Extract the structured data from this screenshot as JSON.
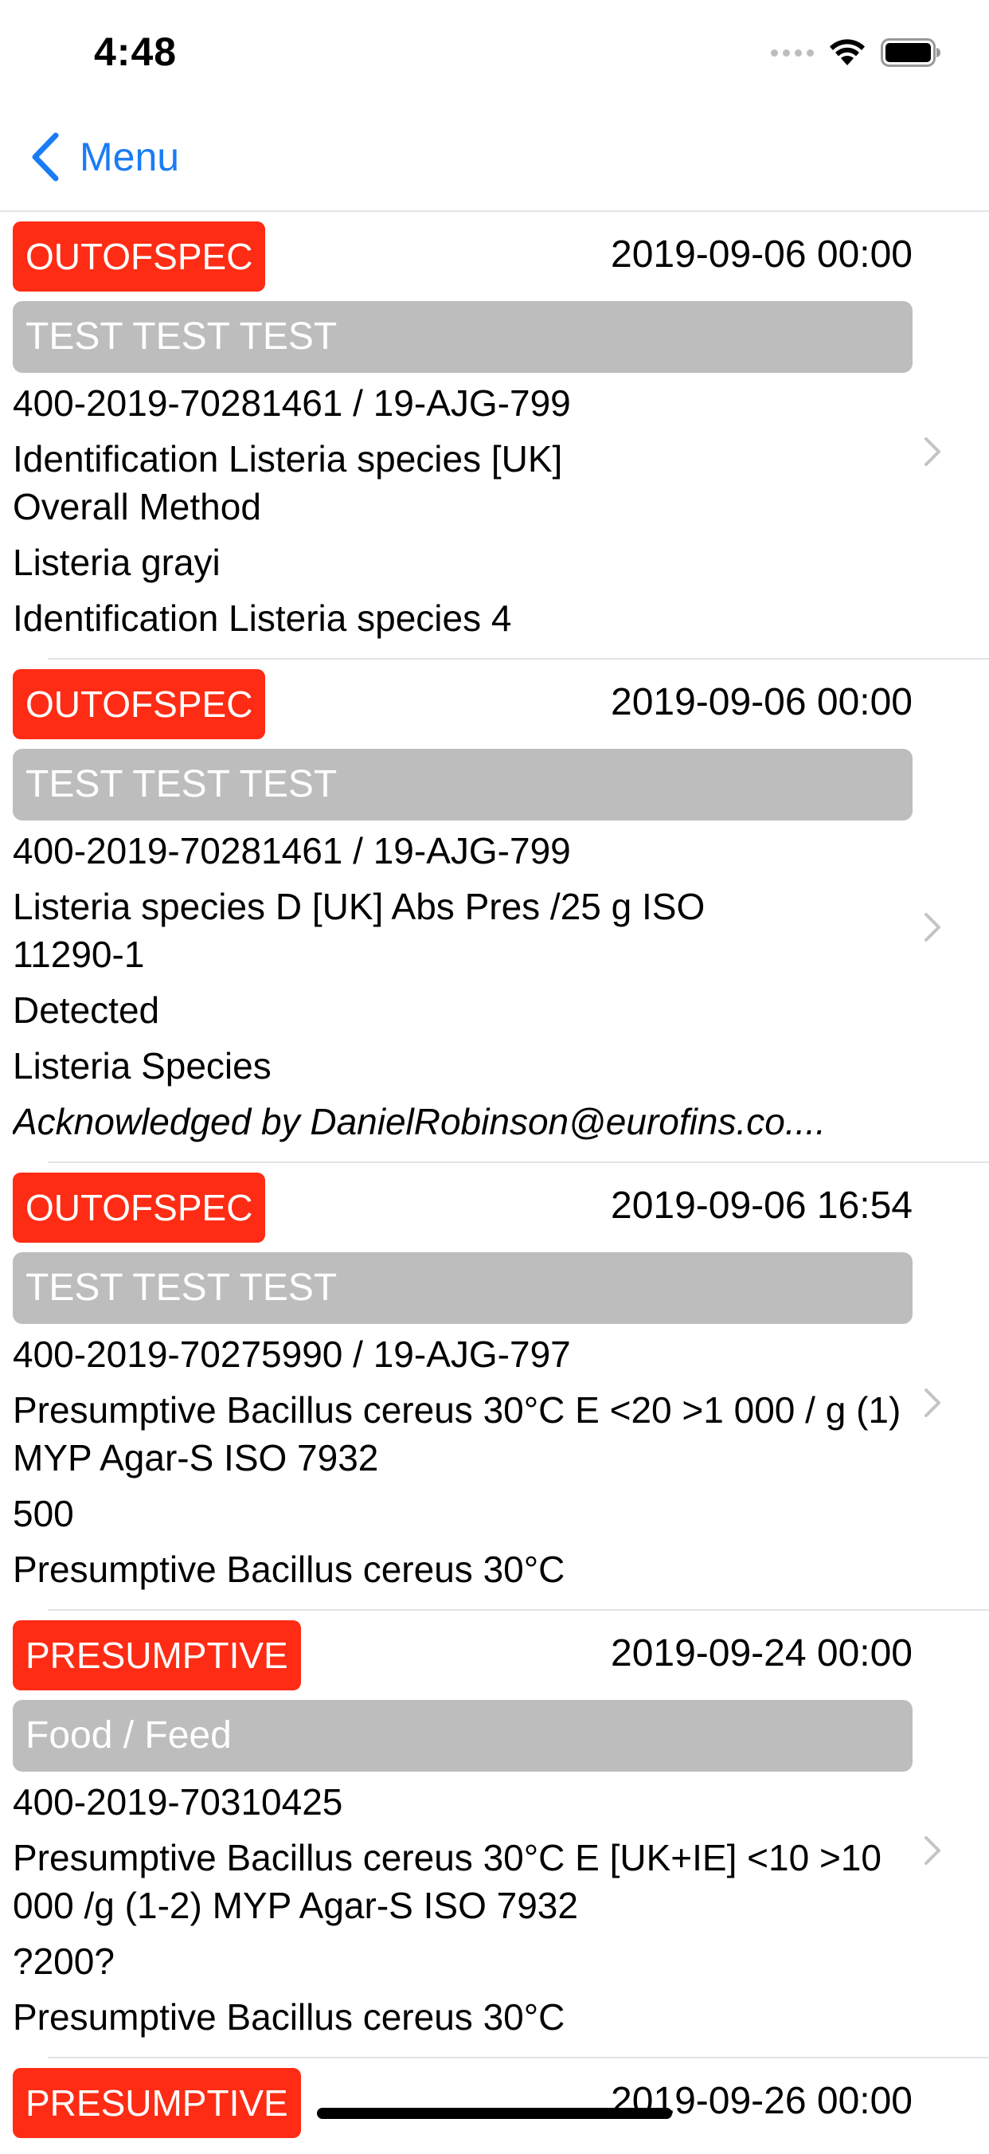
{
  "status_bar": {
    "time": "4:48"
  },
  "nav": {
    "back_label": "Menu"
  },
  "colors": {
    "accent": "#1a7cf5",
    "badge_red": "#fe2c14",
    "category_gray": "#bdbdbd"
  },
  "icons": [
    "chevron-left-icon",
    "wifi-icon",
    "battery-icon",
    "signal-icon",
    "chevron-right-icon"
  ],
  "items": [
    {
      "status": "OUTOFSPEC",
      "date": "2019-09-06 00:00",
      "category": "TEST TEST TEST",
      "lines": [
        "400-2019-70281461 / 19-AJG-799",
        "Identification Listeria species [UK]",
        "Overall Method",
        "Listeria grayi",
        "Identification Listeria species 4"
      ]
    },
    {
      "status": "OUTOFSPEC",
      "date": "2019-09-06 00:00",
      "category": "TEST TEST TEST",
      "lines": [
        "400-2019-70281461 / 19-AJG-799",
        "Listeria species D [UK] Abs Pres /25 g ISO 11290-1",
        "Detected",
        "Listeria Species",
        "Acknowledged by DanielRobinson@eurofins.co...."
      ]
    },
    {
      "status": "OUTOFSPEC",
      "date": "2019-09-06 16:54",
      "category": "TEST TEST TEST",
      "lines": [
        "400-2019-70275990 / 19-AJG-797",
        "Presumptive Bacillus cereus 30°C E <20 >1 000 / g (1) MYP Agar-S ISO 7932",
        "500",
        "Presumptive Bacillus cereus 30°C"
      ]
    },
    {
      "status": "PRESUMPTIVE",
      "date": "2019-09-24 00:00",
      "category": "Food / Feed",
      "lines": [
        "400-2019-70310425",
        "Presumptive Bacillus cereus 30°C E [UK+IE] <10 >10 000 /g (1-2) MYP Agar-S ISO 7932",
        "?200?",
        "Presumptive Bacillus cereus 30°C"
      ]
    },
    {
      "status": "PRESUMPTIVE",
      "date": "2019-09-26 00:00"
    }
  ]
}
